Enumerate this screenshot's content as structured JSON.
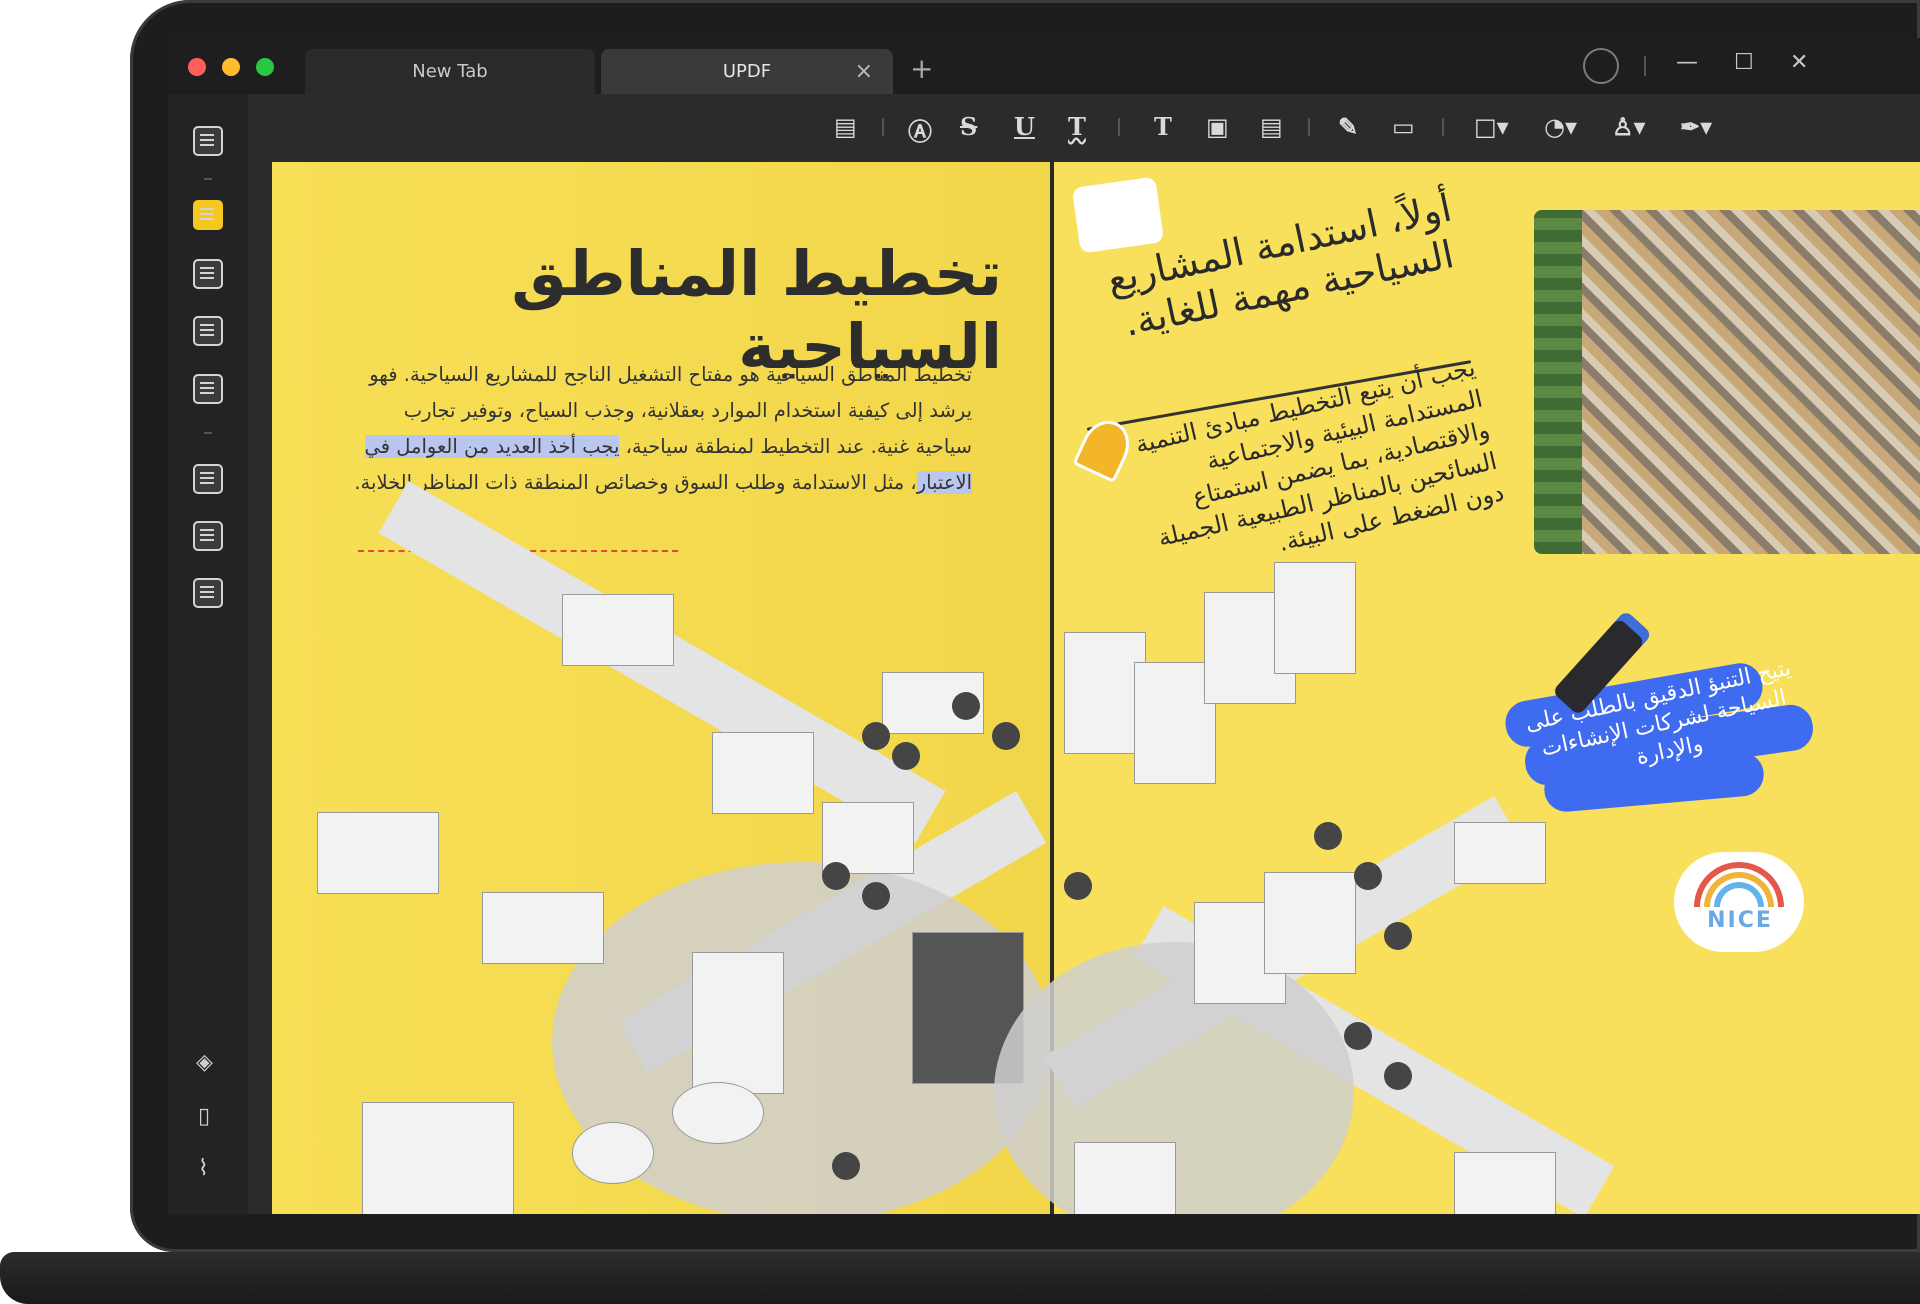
{
  "window": {
    "tabs": [
      {
        "label": "New Tab"
      },
      {
        "label": "UPDF"
      }
    ],
    "close_tab_glyph": "×",
    "new_tab_glyph": "+",
    "controls": {
      "minimize": "—",
      "maximize": "☐",
      "close": "✕"
    }
  },
  "toolbar": {
    "strike": "S",
    "underline": "U",
    "squiggly": "T",
    "text": "T"
  },
  "sidebar_bottom": {
    "layers_glyph": "◈",
    "bookmark_glyph": "▯",
    "attachment_glyph": "⌇"
  },
  "left_page": {
    "title": "تخطيط المناطق السياحية",
    "body_part1": "تخطيط المناطق السياحية هو مفتاح التشغيل الناجح للمشاريع السياحية. فهو يرشد إلى كيفية استخدام الموارد بعقلانية، وجذب السياح، وتوفير تجارب سياحية غنية. عند التخطيط لمنطقة سياحية، ",
    "body_highlight": "يجب أخذ العديد من العوامل في الاعتبار",
    "body_part2": "، مثل الاستدامة وطلب السوق وخصائص المنطقة ذات المناظر الخلابة."
  },
  "right_page": {
    "heading": "أولاً، استدامة المشاريع السياحية مهمة للغاية.",
    "body": "يجب أن يتبع التخطيط مبادئ التنمية المستدامة البيئية والاجتماعية والاقتصادية، بما يضمن استمتاع السائحين بالمناظر الطبيعية الجميلة دون الضغط على البيئة.",
    "sticky_note": "يتيح التنبؤ الدقيق بالطلب على السياحة لشركات الإنشاءات والإدارة",
    "sticker_label": "NICE"
  },
  "colors": {
    "page": "#f7dd55",
    "highlight": "#b9c6ef",
    "note_blue": "#3e6bf0",
    "accent": "#f4c81f"
  },
  "icons": [
    "book-icon",
    "highlighter-icon",
    "edit-icon",
    "organize-icon",
    "form-icon",
    "pages-icon",
    "crop-icon",
    "compress-icon",
    "layers-icon",
    "bookmark-icon",
    "attachment-icon",
    "user-icon",
    "comment-icon",
    "pen-icon",
    "shape-icon",
    "sticker-icon",
    "stamp-icon",
    "signature-icon"
  ]
}
